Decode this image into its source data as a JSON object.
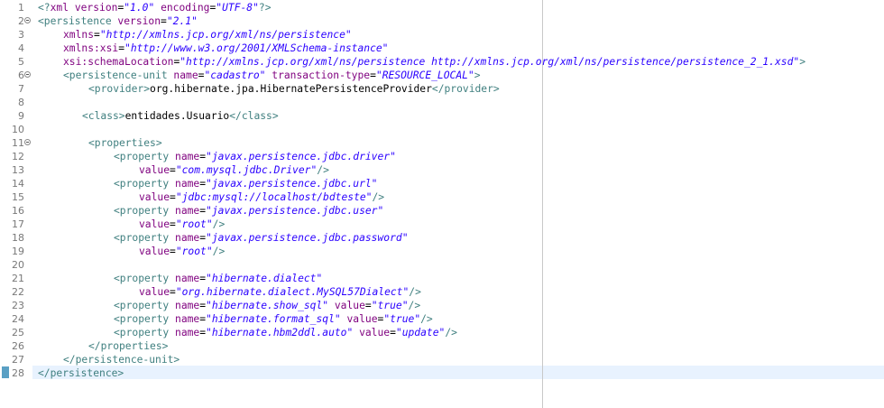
{
  "editor": {
    "current_line": 28,
    "lines": [
      {
        "n": "1",
        "indent": 0,
        "fold": false,
        "tokens": [
          {
            "c": "t",
            "s": "<?"
          },
          {
            "c": "a",
            "s": "xml "
          },
          {
            "c": "a",
            "s": "version"
          },
          {
            "c": "x",
            "s": "="
          },
          {
            "c": "v",
            "s": "\"1.0\""
          },
          {
            "c": "a",
            "s": " encoding"
          },
          {
            "c": "x",
            "s": "="
          },
          {
            "c": "v",
            "s": "\"UTF-8\""
          },
          {
            "c": "t",
            "s": "?>"
          }
        ]
      },
      {
        "n": "2",
        "indent": 0,
        "fold": true,
        "tokens": [
          {
            "c": "t",
            "s": "<persistence"
          },
          {
            "c": "a",
            "s": " version"
          },
          {
            "c": "x",
            "s": "="
          },
          {
            "c": "v",
            "s": "\"2.1\""
          }
        ]
      },
      {
        "n": "3",
        "indent": 4,
        "fold": false,
        "tokens": [
          {
            "c": "a",
            "s": "xmlns"
          },
          {
            "c": "x",
            "s": "="
          },
          {
            "c": "v",
            "s": "\"http://xmlns.jcp.org/xml/ns/persistence\""
          }
        ]
      },
      {
        "n": "4",
        "indent": 4,
        "fold": false,
        "tokens": [
          {
            "c": "a",
            "s": "xmlns:xsi"
          },
          {
            "c": "x",
            "s": "="
          },
          {
            "c": "v",
            "s": "\"http://www.w3.org/2001/XMLSchema-instance\""
          }
        ]
      },
      {
        "n": "5",
        "indent": 4,
        "fold": false,
        "tokens": [
          {
            "c": "a",
            "s": "xsi:schemaLocation"
          },
          {
            "c": "x",
            "s": "="
          },
          {
            "c": "v",
            "s": "\"http://xmlns.jcp.org/xml/ns/persistence http://xmlns.jcp.org/xml/ns/persistence/persistence_2_1.xsd\""
          },
          {
            "c": "t",
            "s": ">"
          }
        ]
      },
      {
        "n": "6",
        "indent": 4,
        "fold": true,
        "tokens": [
          {
            "c": "t",
            "s": "<persistence-unit"
          },
          {
            "c": "a",
            "s": " name"
          },
          {
            "c": "x",
            "s": "="
          },
          {
            "c": "v",
            "s": "\"cadastro\""
          },
          {
            "c": "a",
            "s": " transaction-type"
          },
          {
            "c": "x",
            "s": "="
          },
          {
            "c": "v",
            "s": "\"RESOURCE_LOCAL\""
          },
          {
            "c": "t",
            "s": ">"
          }
        ]
      },
      {
        "n": "7",
        "indent": 8,
        "fold": false,
        "tokens": [
          {
            "c": "t",
            "s": "<provider>"
          },
          {
            "c": "x",
            "s": "org.hibernate.jpa.HibernatePersistenceProvider"
          },
          {
            "c": "t",
            "s": "</provider>"
          }
        ]
      },
      {
        "n": "8",
        "indent": 0,
        "fold": false,
        "tokens": []
      },
      {
        "n": "9",
        "indent": 7,
        "fold": false,
        "tokens": [
          {
            "c": "t",
            "s": "<class>"
          },
          {
            "c": "x",
            "s": "entidades.Usuario"
          },
          {
            "c": "t",
            "s": "</class>"
          }
        ]
      },
      {
        "n": "10",
        "indent": 0,
        "fold": false,
        "tokens": []
      },
      {
        "n": "11",
        "indent": 8,
        "fold": true,
        "tokens": [
          {
            "c": "t",
            "s": "<properties>"
          }
        ]
      },
      {
        "n": "12",
        "indent": 12,
        "fold": false,
        "tokens": [
          {
            "c": "t",
            "s": "<property"
          },
          {
            "c": "a",
            "s": " name"
          },
          {
            "c": "x",
            "s": "="
          },
          {
            "c": "v",
            "s": "\"javax.persistence.jdbc.driver\""
          }
        ]
      },
      {
        "n": "13",
        "indent": 16,
        "fold": false,
        "tokens": [
          {
            "c": "a",
            "s": "value"
          },
          {
            "c": "x",
            "s": "="
          },
          {
            "c": "v",
            "s": "\"com.mysql.jdbc.Driver\""
          },
          {
            "c": "t",
            "s": "/>"
          }
        ]
      },
      {
        "n": "14",
        "indent": 12,
        "fold": false,
        "tokens": [
          {
            "c": "t",
            "s": "<property"
          },
          {
            "c": "a",
            "s": " name"
          },
          {
            "c": "x",
            "s": "="
          },
          {
            "c": "v",
            "s": "\"javax.persistence.jdbc.url\""
          }
        ]
      },
      {
        "n": "15",
        "indent": 16,
        "fold": false,
        "tokens": [
          {
            "c": "a",
            "s": "value"
          },
          {
            "c": "x",
            "s": "="
          },
          {
            "c": "v",
            "s": "\"jdbc:mysql://localhost/bdteste\""
          },
          {
            "c": "t",
            "s": "/>"
          }
        ]
      },
      {
        "n": "16",
        "indent": 12,
        "fold": false,
        "tokens": [
          {
            "c": "t",
            "s": "<property"
          },
          {
            "c": "a",
            "s": " name"
          },
          {
            "c": "x",
            "s": "="
          },
          {
            "c": "v",
            "s": "\"javax.persistence.jdbc.user\""
          }
        ]
      },
      {
        "n": "17",
        "indent": 16,
        "fold": false,
        "tokens": [
          {
            "c": "a",
            "s": "value"
          },
          {
            "c": "x",
            "s": "="
          },
          {
            "c": "v",
            "s": "\"root\""
          },
          {
            "c": "t",
            "s": "/>"
          }
        ]
      },
      {
        "n": "18",
        "indent": 12,
        "fold": false,
        "tokens": [
          {
            "c": "t",
            "s": "<property"
          },
          {
            "c": "a",
            "s": " name"
          },
          {
            "c": "x",
            "s": "="
          },
          {
            "c": "v",
            "s": "\"javax.persistence.jdbc.password\""
          }
        ]
      },
      {
        "n": "19",
        "indent": 16,
        "fold": false,
        "tokens": [
          {
            "c": "a",
            "s": "value"
          },
          {
            "c": "x",
            "s": "="
          },
          {
            "c": "v",
            "s": "\"root\""
          },
          {
            "c": "t",
            "s": "/>"
          }
        ]
      },
      {
        "n": "20",
        "indent": 0,
        "fold": false,
        "tokens": []
      },
      {
        "n": "21",
        "indent": 12,
        "fold": false,
        "tokens": [
          {
            "c": "t",
            "s": "<property"
          },
          {
            "c": "a",
            "s": " name"
          },
          {
            "c": "x",
            "s": "="
          },
          {
            "c": "v",
            "s": "\"hibernate.dialect\""
          }
        ]
      },
      {
        "n": "22",
        "indent": 16,
        "fold": false,
        "tokens": [
          {
            "c": "a",
            "s": "value"
          },
          {
            "c": "x",
            "s": "="
          },
          {
            "c": "v",
            "s": "\"org.hibernate.dialect.MySQL57Dialect\""
          },
          {
            "c": "t",
            "s": "/>"
          }
        ]
      },
      {
        "n": "23",
        "indent": 12,
        "fold": false,
        "tokens": [
          {
            "c": "t",
            "s": "<property"
          },
          {
            "c": "a",
            "s": " name"
          },
          {
            "c": "x",
            "s": "="
          },
          {
            "c": "v",
            "s": "\"hibernate.show_sql\""
          },
          {
            "c": "a",
            "s": " value"
          },
          {
            "c": "x",
            "s": "="
          },
          {
            "c": "v",
            "s": "\"true\""
          },
          {
            "c": "t",
            "s": "/>"
          }
        ]
      },
      {
        "n": "24",
        "indent": 12,
        "fold": false,
        "tokens": [
          {
            "c": "t",
            "s": "<property"
          },
          {
            "c": "a",
            "s": " name"
          },
          {
            "c": "x",
            "s": "="
          },
          {
            "c": "v",
            "s": "\"hibernate.format_sql\""
          },
          {
            "c": "a",
            "s": " value"
          },
          {
            "c": "x",
            "s": "="
          },
          {
            "c": "v",
            "s": "\"true\""
          },
          {
            "c": "t",
            "s": "/>"
          }
        ]
      },
      {
        "n": "25",
        "indent": 12,
        "fold": false,
        "tokens": [
          {
            "c": "t",
            "s": "<property"
          },
          {
            "c": "a",
            "s": " name"
          },
          {
            "c": "x",
            "s": "="
          },
          {
            "c": "v",
            "s": "\"hibernate.hbm2ddl.auto\""
          },
          {
            "c": "a",
            "s": " value"
          },
          {
            "c": "x",
            "s": "="
          },
          {
            "c": "v",
            "s": "\"update\""
          },
          {
            "c": "t",
            "s": "/>"
          }
        ]
      },
      {
        "n": "26",
        "indent": 8,
        "fold": false,
        "tokens": [
          {
            "c": "t",
            "s": "</properties>"
          }
        ]
      },
      {
        "n": "27",
        "indent": 4,
        "fold": false,
        "tokens": [
          {
            "c": "t",
            "s": "</persistence-unit>"
          }
        ]
      },
      {
        "n": "28",
        "indent": 0,
        "fold": false,
        "tokens": [
          {
            "c": "t",
            "s": "</persistence>"
          }
        ]
      }
    ]
  },
  "colors": {
    "tag": "#3f7f7f",
    "attribute": "#7f007f",
    "value": "#2a00ff",
    "text": "#000000",
    "line_number": "#787878",
    "current_line": "#e8f2fe",
    "print_margin": "#c8c8c8"
  },
  "icons": {
    "fold": "collapse-fold-icon",
    "change_marker": "change-marker-icon"
  }
}
